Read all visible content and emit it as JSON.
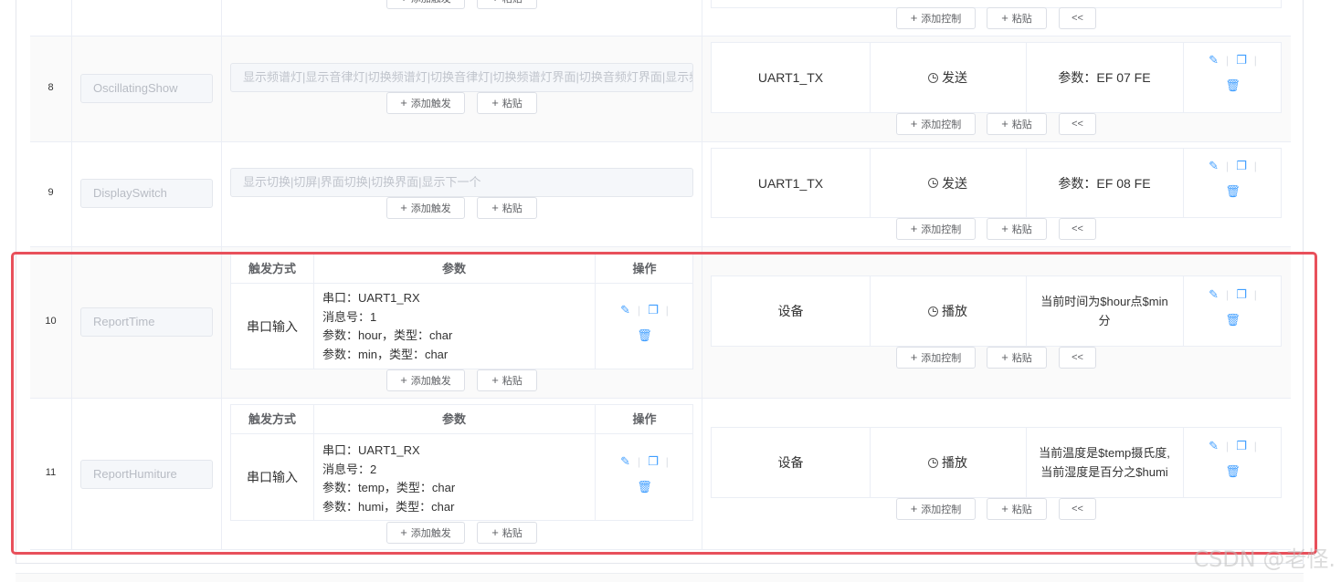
{
  "buttons": {
    "add_trigger": "添加触发",
    "paste": "粘贴",
    "add_control": "添加控制",
    "collapse": "<<"
  },
  "icons": {
    "edit": "pencil-icon",
    "copy": "copy-icon",
    "delete": "trash-icon",
    "clock": "clock-icon"
  },
  "trigger_headers": {
    "mode": "触发方式",
    "params": "参数",
    "ops": "操作"
  },
  "rows": [
    {
      "index": "8",
      "name": "OscillatingShow",
      "trigger_text": "显示频谱灯|显示音律灯|切换频谱灯|切换音律灯|切换频谱灯界面|切换音频灯界面|显示频",
      "control": {
        "target": "UART1_TX",
        "action": "发送",
        "value": "参数：EF 07 FE"
      }
    },
    {
      "index": "9",
      "name": "DisplaySwitch",
      "trigger_text": "显示切换|切屏|界面切换|切换界面|显示下一个",
      "control": {
        "target": "UART1_TX",
        "action": "发送",
        "value": "参数：EF 08 FE"
      }
    },
    {
      "index": "10",
      "name": "ReportTime",
      "trigger": {
        "mode": "串口输入",
        "params": [
          "串口：UART1_RX",
          "消息号：1",
          "参数：hour，类型：char",
          "参数：min，类型：char"
        ]
      },
      "control": {
        "target": "设备",
        "action": "播放",
        "value_line1": "当前时间为$hour点$min",
        "value_line2": "分"
      }
    },
    {
      "index": "11",
      "name": "ReportHumiture",
      "trigger": {
        "mode": "串口输入",
        "params": [
          "串口：UART1_RX",
          "消息号：2",
          "参数：temp，类型：char",
          "参数：humi，类型：char"
        ]
      },
      "control": {
        "target": "设备",
        "action": "播放",
        "value_line1": "当前温度是$temp摄氏度,",
        "value_line2": "当前湿度是百分之$humi"
      }
    }
  ],
  "watermark": "CSDN @老怪."
}
